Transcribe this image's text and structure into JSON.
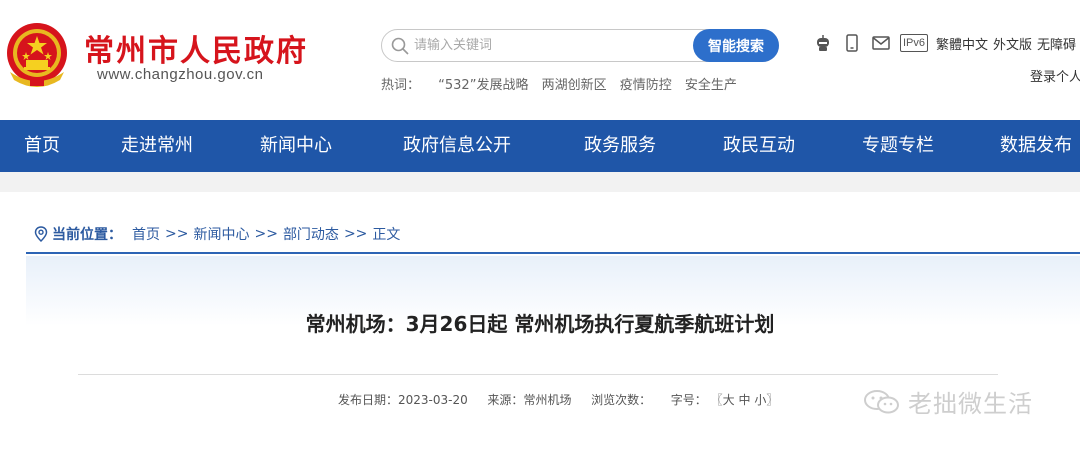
{
  "header": {
    "site_name": "常州市人民政府",
    "site_url": "www.changzhou.gov.cn"
  },
  "search": {
    "placeholder": "请输入关键词",
    "button_label": "智能搜索",
    "hot_label": "热词：",
    "hot_words": [
      "“532”发展战略",
      "两湖创新区",
      "疫情防控",
      "安全生产"
    ]
  },
  "toolbar": {
    "ipv6_label": "IPv6",
    "traditional": "繁體中文",
    "foreign": "外文版",
    "accessible": "无障碍",
    "login": "登录个人"
  },
  "nav": {
    "items": [
      "首页",
      "走进常州",
      "新闻中心",
      "政府信息公开",
      "政务服务",
      "政民互动",
      "专题专栏",
      "数据发布"
    ]
  },
  "breadcrumb": {
    "label": "当前位置：",
    "items": [
      "首页",
      "新闻中心",
      "部门动态",
      "正文"
    ],
    "separator": ">>"
  },
  "article": {
    "title": "常州机场：3月26日起 常州机场执行夏航季航班计划",
    "publish_label": "发布日期：",
    "publish_date": "2023-03-20",
    "source_label": "来源：",
    "source": "常州机场",
    "views_label": "浏览次数：",
    "font_label": "字号：",
    "font_open": "〖",
    "font_large": "大",
    "font_medium": "中",
    "font_small": "小",
    "font_close": "〗"
  },
  "watermark": {
    "text": "老拙微生活"
  },
  "colors": {
    "brand_red": "#d6141c",
    "nav_blue": "#1f56a8",
    "search_blue": "#2d6fcb"
  }
}
